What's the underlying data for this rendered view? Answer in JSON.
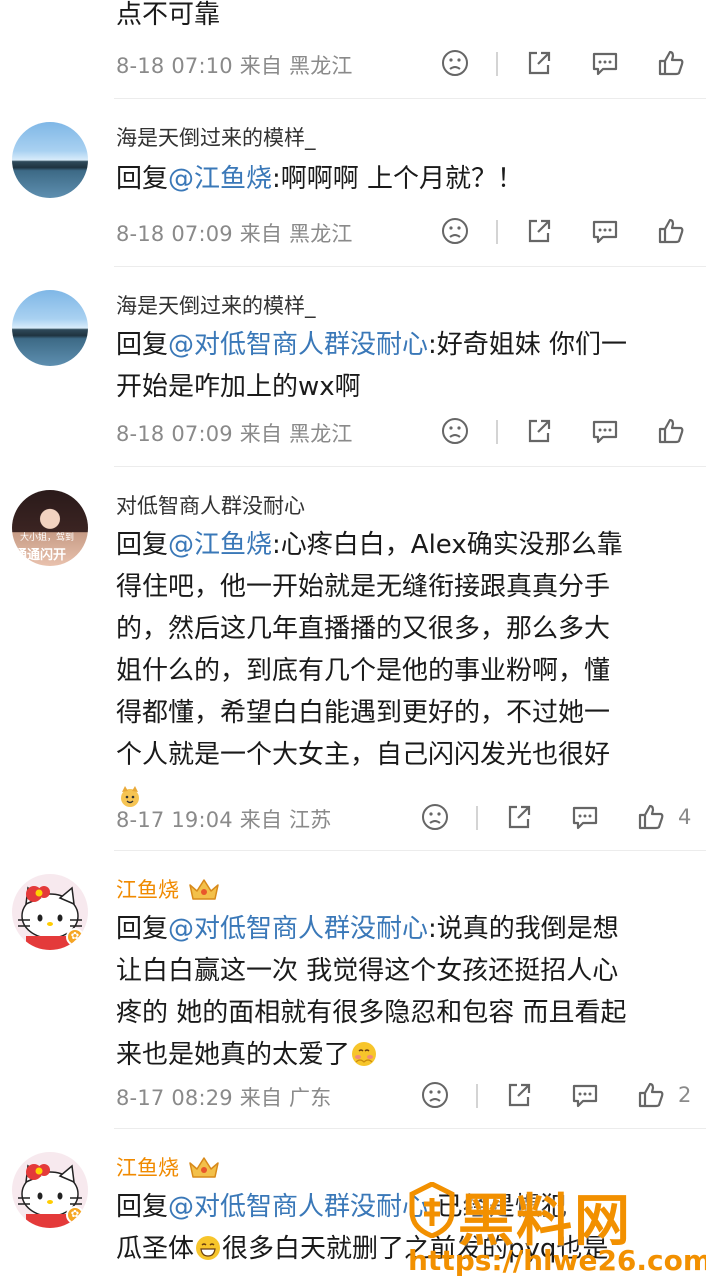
{
  "comments": [
    {
      "text": "点不可靠",
      "meta": "8-18 07:10 来自 黑龙江",
      "like_count": ""
    },
    {
      "username": "海是天倒过来的模样_",
      "reply_prefix": "回复",
      "mention": "@江鱼烧",
      "text": ":啊啊啊 上个月就？！",
      "meta": "8-18 07:09 来自 黑龙江",
      "like_count": ""
    },
    {
      "username": "海是天倒过来的模样_",
      "reply_prefix": "回复",
      "mention": "@对低智商人群没耐心",
      "text_line1": ":好奇姐妹 你们一",
      "text_line2": "开始是咋加上的wx啊",
      "meta": "8-18 07:09 来自 黑龙江",
      "like_count": ""
    },
    {
      "username": "对低智商人群没耐心",
      "avatar_text1": "大小姐，驾到",
      "avatar_text2": "通通闪开",
      "reply_prefix": "回复",
      "mention": "@江鱼烧",
      "text_line1": ":心疼白白，Alex确实没那么靠",
      "text_line2": "得住吧，他一开始就是无缝衔接跟真真分手",
      "text_line3": "的，然后这几年直播播的又很多，那么多大",
      "text_line4": "姐什么的，到底有几个是他的事业粉啊，懂",
      "text_line5": "得都懂，希望白白能遇到更好的，不过她一",
      "text_line6": "个人就是一个大女主，自己闪闪发光也很好",
      "meta": "8-17 19:04 来自 江苏",
      "like_count": "4"
    },
    {
      "username": "江鱼烧",
      "reply_prefix": "回复",
      "mention": "@对低智商人群没耐心",
      "text_line1": ":说真的我倒是想",
      "text_line2": "让白白赢这一次 我觉得这个女孩还挺招人心",
      "text_line3": "疼的 她的面相就有很多隐忍和包容 而且看起",
      "text_line4": "来也是她真的太爱了",
      "meta": "8-17 08:29 来自 广东",
      "like_count": "2"
    },
    {
      "username": "江鱼烧",
      "reply_prefix": "回复",
      "mention": "@对低智商人群没耐心",
      "text_line1": ":已经是惯犯",
      "text_line2": "瓜圣体",
      "text_line2b": "很多白天就删了之前发的pyq也是"
    }
  ],
  "watermark": {
    "title": "黑料网",
    "url": "https://hlwe26.com"
  },
  "colors": {
    "mention": "#3a78b8",
    "vip_name": "#f08a00",
    "meta": "#8a8a8a"
  }
}
